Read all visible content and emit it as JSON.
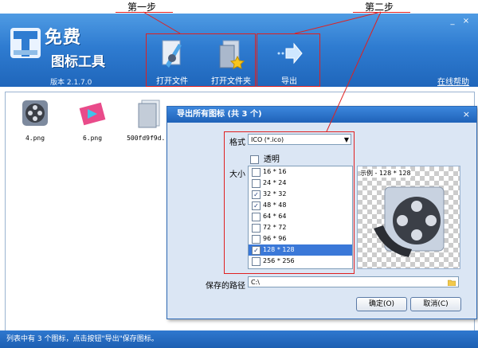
{
  "annotations": {
    "step1": "第一步",
    "step2": "第二步"
  },
  "app": {
    "title_line1": "免费",
    "title_line2": "图标工具",
    "version": "版本 2.1.7.0",
    "help_link": "在线帮助"
  },
  "toolbar": {
    "open_file": "打开文件",
    "open_folder": "打开文件夹",
    "export": "导出"
  },
  "window_controls": {
    "minimize": "_",
    "close": "×"
  },
  "files": [
    {
      "name": "4.png",
      "icon": "film-reel-icon"
    },
    {
      "name": "6.png",
      "icon": "film-strip-icon"
    },
    {
      "name": "500fd9f9d...",
      "icon": "folder-icon"
    }
  ],
  "status": "列表中有 3 个图标，点击按钮\"导出\"保存图标。",
  "dialog": {
    "title": "导出所有图标 (共 3 个)",
    "close": "×",
    "format_label": "格式",
    "format_value": "ICO (*.ico)",
    "transparent_label": "透明",
    "transparent_checked": false,
    "size_label": "大小",
    "sizes": [
      {
        "label": "16 * 16",
        "checked": false
      },
      {
        "label": "24 * 24",
        "checked": false
      },
      {
        "label": "32 * 32",
        "checked": true
      },
      {
        "label": "48 * 48",
        "checked": true
      },
      {
        "label": "64 * 64",
        "checked": false
      },
      {
        "label": "72 * 72",
        "checked": false
      },
      {
        "label": "96 * 96",
        "checked": false
      },
      {
        "label": "128 * 128",
        "checked": true,
        "selected": true
      },
      {
        "label": "256 * 256",
        "checked": false
      }
    ],
    "preview_caption": "示例 - 128 * 128",
    "path_label": "保存的路径",
    "path_value": "C:\\",
    "ok_button": "确定(O)",
    "cancel_button": "取消(C)"
  },
  "colors": {
    "header": "#2f7cd1",
    "annotation": "#e02020",
    "selection": "#3a78d8"
  }
}
